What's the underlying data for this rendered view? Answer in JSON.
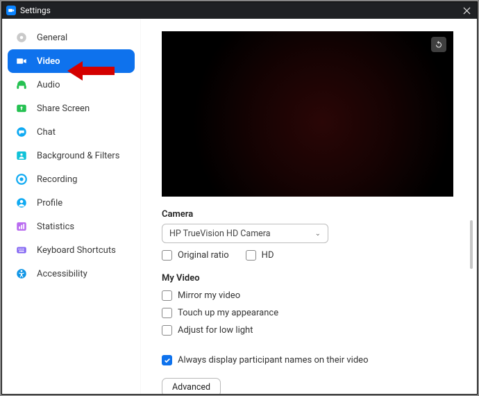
{
  "window": {
    "title": "Settings"
  },
  "sidebar": {
    "items": [
      {
        "label": "General",
        "icon": "gear-icon",
        "color": "#c9c9c9"
      },
      {
        "label": "Video",
        "icon": "video-icon",
        "color": "#ffffff",
        "active": true
      },
      {
        "label": "Audio",
        "icon": "headphones-icon",
        "color": "#25c151"
      },
      {
        "label": "Share Screen",
        "icon": "share-screen-icon",
        "color": "#25c151"
      },
      {
        "label": "Chat",
        "icon": "chat-icon",
        "color": "#10aaf2"
      },
      {
        "label": "Background & Filters",
        "icon": "background-icon",
        "color": "#10c2d8"
      },
      {
        "label": "Recording",
        "icon": "recording-icon",
        "color": "#10aaf2"
      },
      {
        "label": "Profile",
        "icon": "profile-icon",
        "color": "#10aaf2"
      },
      {
        "label": "Statistics",
        "icon": "statistics-icon",
        "color": "#b96bf0"
      },
      {
        "label": "Keyboard Shortcuts",
        "icon": "keyboard-icon",
        "color": "#8568f3"
      },
      {
        "label": "Accessibility",
        "icon": "accessibility-icon",
        "color": "#1196e6"
      }
    ]
  },
  "video": {
    "camera_label": "Camera",
    "camera_selected": "HP TrueVision HD Camera",
    "original_ratio": "Original ratio",
    "hd": "HD",
    "myvideo_label": "My Video",
    "mirror": "Mirror my video",
    "touchup": "Touch up my appearance",
    "lowlight": "Adjust for low light",
    "always_names": "Always display participant names on their video",
    "advanced": "Advanced"
  }
}
